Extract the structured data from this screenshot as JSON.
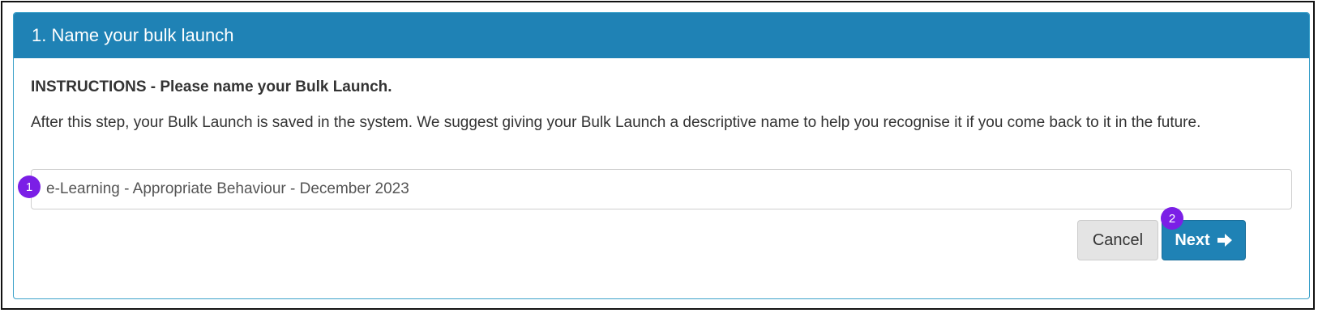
{
  "panel": {
    "title": "1. Name your bulk launch"
  },
  "body": {
    "instructions": "INSTRUCTIONS - Please name your Bulk Launch.",
    "description": "After this step, your Bulk Launch is saved in the system. We suggest giving your Bulk Launch a descriptive name to help you recognise it if you come back to it in the future."
  },
  "name_field": {
    "value": "e-Learning - Appropriate Behaviour - December 2023"
  },
  "buttons": {
    "cancel_label": "Cancel",
    "next_label": "Next",
    "next_icon": "arrow-right-icon"
  },
  "badges": {
    "first": "1",
    "second": "2"
  },
  "colors": {
    "header": "#1f82b5",
    "badge": "#7b1fe6",
    "primary_button": "#1f82b5"
  }
}
